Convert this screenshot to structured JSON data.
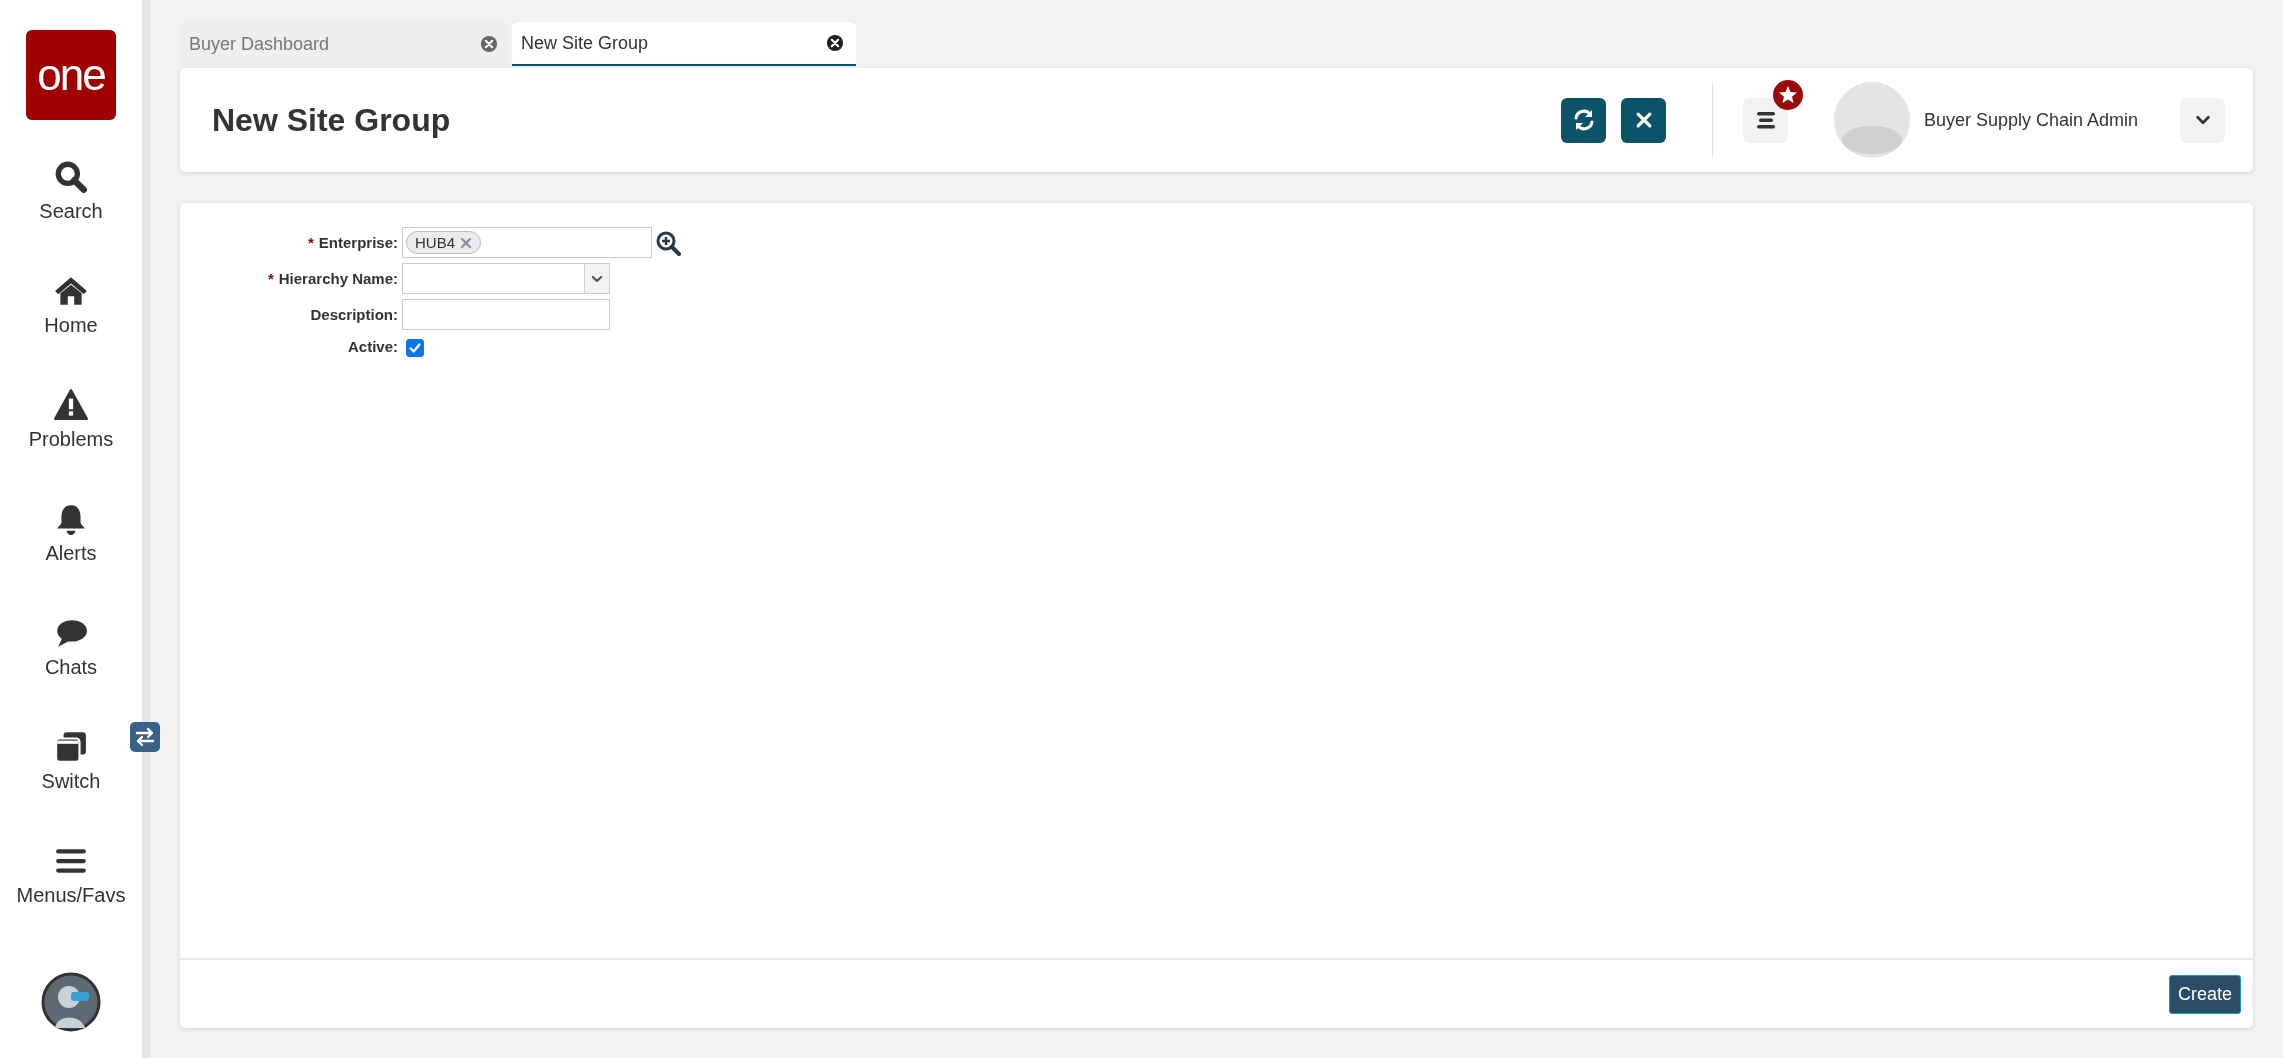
{
  "sidebar": {
    "logo": "one",
    "items": [
      {
        "label": "Search",
        "kind": "search"
      },
      {
        "label": "Home",
        "kind": "home"
      },
      {
        "label": "Problems",
        "kind": "warning"
      },
      {
        "label": "Alerts",
        "kind": "bell"
      },
      {
        "label": "Chats",
        "kind": "chat"
      },
      {
        "label": "Switch",
        "kind": "switch"
      },
      {
        "label": "Menus/Favs",
        "kind": "menu"
      }
    ]
  },
  "tabs": [
    {
      "label": "Buyer Dashboard",
      "selected": false
    },
    {
      "label": "New Site Group",
      "selected": true
    }
  ],
  "header": {
    "title": "New Site Group",
    "user_role": "Buyer Supply Chain Admin"
  },
  "form": {
    "fields": [
      {
        "marker": "*",
        "label": "Enterprise:",
        "kind": "tags",
        "tags": [
          "HUB4"
        ]
      },
      {
        "marker": "*",
        "label": "Hierarchy Name:",
        "kind": "select"
      },
      {
        "label": "Description:",
        "kind": "text"
      },
      {
        "label": "Active:",
        "kind": "checkbox",
        "checked": true
      }
    ]
  },
  "footer": {
    "button": "Create"
  }
}
